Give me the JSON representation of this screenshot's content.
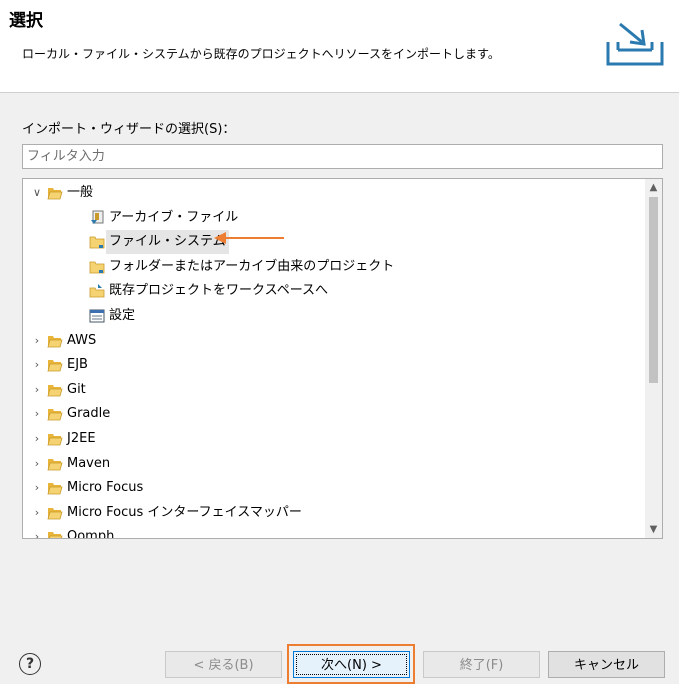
{
  "header": {
    "title": "選択",
    "description": "ローカル・ファイル・システムから既存のプロジェクトへリソースをインポートします。",
    "banner_icon": "import-tray-icon"
  },
  "wizard_section": {
    "label": "インポート・ウィザードの選択(S)：",
    "filter_placeholder": "フィルタ入力",
    "filter_value": ""
  },
  "tree": {
    "items": [
      {
        "label": "一般",
        "level": 0,
        "state": "expanded",
        "icon": "folder-open-icon"
      },
      {
        "label": "アーカイブ・ファイル",
        "level": 1,
        "icon": "archive-file-icon"
      },
      {
        "label": "ファイル・システム",
        "level": 1,
        "icon": "folder-icon",
        "selected": true
      },
      {
        "label": "フォルダーまたはアーカイブ由来のプロジェクト",
        "level": 1,
        "icon": "folder-icon"
      },
      {
        "label": "既存プロジェクトをワークスペースへ",
        "level": 1,
        "icon": "project-import-icon"
      },
      {
        "label": "設定",
        "level": 1,
        "icon": "preferences-icon"
      },
      {
        "label": "AWS",
        "level": 0,
        "state": "collapsed",
        "icon": "folder-open-icon"
      },
      {
        "label": "EJB",
        "level": 0,
        "state": "collapsed",
        "icon": "folder-open-icon"
      },
      {
        "label": "Git",
        "level": 0,
        "state": "collapsed",
        "icon": "folder-open-icon"
      },
      {
        "label": "Gradle",
        "level": 0,
        "state": "collapsed",
        "icon": "folder-open-icon"
      },
      {
        "label": "J2EE",
        "level": 0,
        "state": "collapsed",
        "icon": "folder-open-icon"
      },
      {
        "label": "Maven",
        "level": 0,
        "state": "collapsed",
        "icon": "folder-open-icon"
      },
      {
        "label": "Micro Focus",
        "level": 0,
        "state": "collapsed",
        "icon": "folder-open-icon"
      },
      {
        "label": "Micro Focus インターフェイスマッパー",
        "level": 0,
        "state": "collapsed",
        "icon": "folder-open-icon"
      },
      {
        "label": "Oomph",
        "level": 0,
        "state": "collapsed",
        "icon": "folder-open-icon"
      }
    ]
  },
  "buttons": {
    "help_icon": "question-icon",
    "back": "< 戻る(B)",
    "next": "次へ(N) >",
    "finish": "終了(F)",
    "cancel": "キャンセル"
  },
  "colors": {
    "highlight": "#ed7d31",
    "selection": "#e5e5e5",
    "folder": "#f0c24a"
  }
}
